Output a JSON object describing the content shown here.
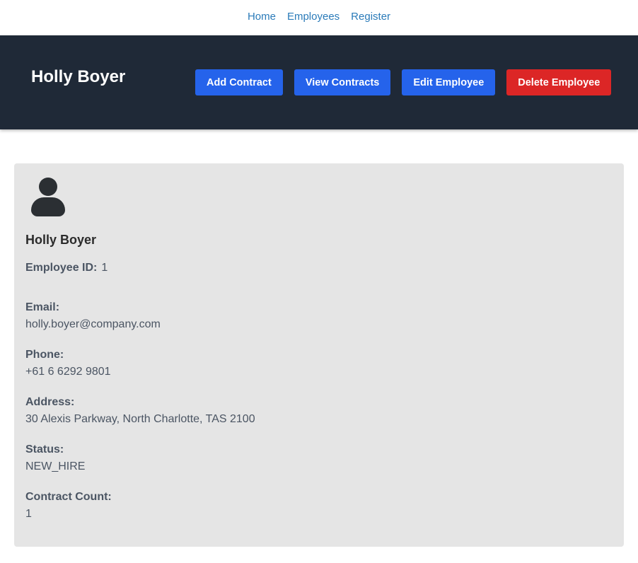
{
  "nav": {
    "links": [
      "Home",
      "Employees",
      "Register"
    ]
  },
  "header": {
    "title": "Holly Boyer",
    "buttons": {
      "add_contract": "Add Contract",
      "view_contracts": "View Contracts",
      "edit_employee": "Edit Employee",
      "delete_employee": "Delete Employee"
    }
  },
  "employee": {
    "name": "Holly Boyer",
    "id_label": "Employee ID:",
    "id": "1",
    "email_label": "Email:",
    "email": "holly.boyer@company.com",
    "phone_label": "Phone:",
    "phone": "+61 6 6292 9801",
    "address_label": "Address:",
    "address": "30 Alexis Parkway, North Charlotte, TAS 2100",
    "status_label": "Status:",
    "status": "NEW_HIRE",
    "contract_count_label": "Contract Count:",
    "contract_count": "1"
  },
  "icons": {
    "avatar": "user-icon"
  },
  "colors": {
    "header_bg": "#1f2937",
    "primary": "#2563eb",
    "danger": "#dc2626",
    "card_bg": "#e5e5e5",
    "link": "#2b7bb9"
  }
}
